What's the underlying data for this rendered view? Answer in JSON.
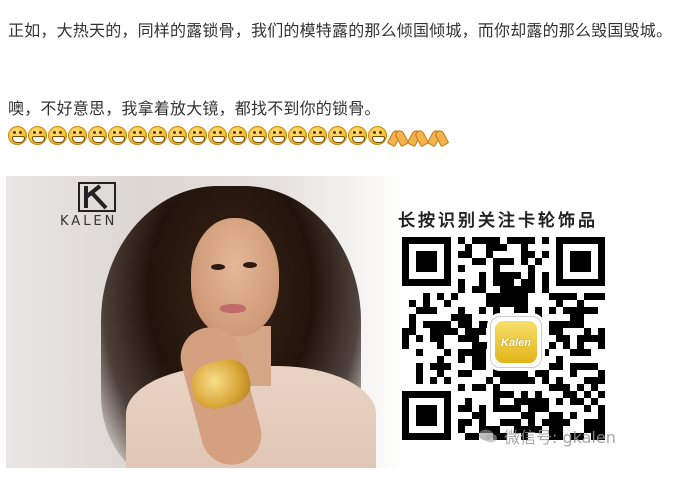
{
  "article": {
    "paragraph1": "正如，大热天的，同样的露锁骨，我们的模特露的那么倾国倾城，而你却露的那么毁国毁城。",
    "paragraph2": "噢，不好意思，我拿着放大镜，都找不到你的锁骨。",
    "emoji_row": {
      "grin_count": 19,
      "pray_count": 3,
      "grin_icon": "grin-emoji-icon",
      "pray_icon": "praying-hands-emoji-icon"
    }
  },
  "banner": {
    "brand_logo_text": "KALEN",
    "qr_title": "长按识别关注卡轮饰品",
    "qr_center_logo_text": "Kalen",
    "watermark": "微信号: gkalen",
    "colors": {
      "gold": "#d9a83a",
      "hair": "#22140c",
      "background": "#e9e6e4"
    }
  }
}
